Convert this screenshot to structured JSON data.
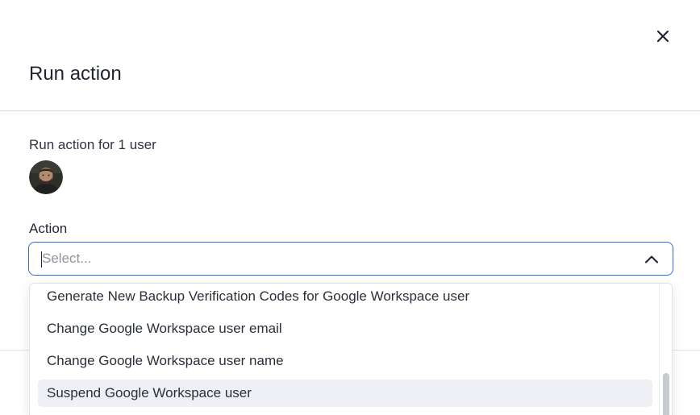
{
  "modal": {
    "title": "Run action",
    "close_icon": "close-icon"
  },
  "target": {
    "label": "Run action for 1 user",
    "avatar_icon": "user-avatar"
  },
  "action_field": {
    "label": "Action",
    "placeholder": "Select...",
    "value": "",
    "expanded": true,
    "chevron_icon": "chevron-up-icon",
    "accent_color": "#2f6fdc"
  },
  "dropdown": {
    "options": [
      {
        "label": "Generate New Backup Verification Codes for Google Workspace user",
        "highlighted": false
      },
      {
        "label": "Change Google Workspace user email",
        "highlighted": false
      },
      {
        "label": "Change Google Workspace user name",
        "highlighted": false
      },
      {
        "label": "Suspend Google Workspace user",
        "highlighted": true
      }
    ],
    "highlight_color": "#eef0f5"
  }
}
